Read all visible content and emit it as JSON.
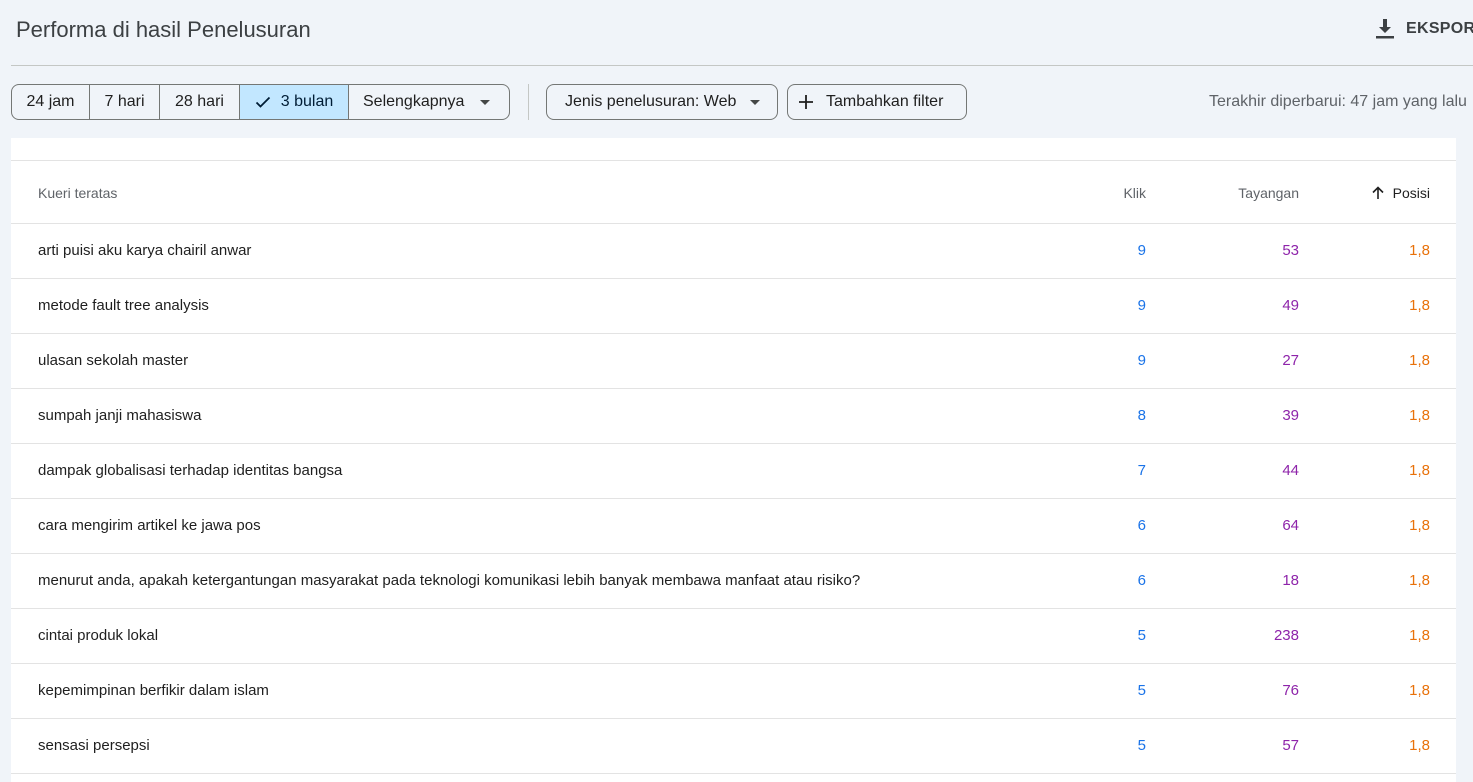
{
  "header": {
    "title": "Performa di hasil Penelusuran",
    "export_label": "EKSPOR"
  },
  "filters": {
    "date_ranges": [
      {
        "label": "24 jam",
        "selected": false
      },
      {
        "label": "7 hari",
        "selected": false
      },
      {
        "label": "28 hari",
        "selected": false
      },
      {
        "label": "3 bulan",
        "selected": true
      },
      {
        "label": "Selengkapnya",
        "selected": false
      }
    ],
    "search_type": "Jenis penelusuran: Web",
    "add_filter": "Tambahkan filter",
    "last_updated": "Terakhir diperbarui: 47 jam yang lalu"
  },
  "table": {
    "headers": {
      "query": "Kueri teratas",
      "clicks": "Klik",
      "impressions": "Tayangan",
      "position": "Posisi"
    },
    "sort": {
      "column": "position",
      "direction": "ascending"
    },
    "rows": [
      {
        "query": "arti puisi aku karya chairil anwar",
        "clicks": "9",
        "impressions": "53",
        "position": "1,8"
      },
      {
        "query": "metode fault tree analysis",
        "clicks": "9",
        "impressions": "49",
        "position": "1,8"
      },
      {
        "query": "ulasan sekolah master",
        "clicks": "9",
        "impressions": "27",
        "position": "1,8"
      },
      {
        "query": "sumpah janji mahasiswa",
        "clicks": "8",
        "impressions": "39",
        "position": "1,8"
      },
      {
        "query": "dampak globalisasi terhadap identitas bangsa",
        "clicks": "7",
        "impressions": "44",
        "position": "1,8"
      },
      {
        "query": "cara mengirim artikel ke jawa pos",
        "clicks": "6",
        "impressions": "64",
        "position": "1,8"
      },
      {
        "query": "menurut anda, apakah ketergantungan masyarakat pada teknologi komunikasi lebih banyak membawa manfaat atau risiko?",
        "clicks": "6",
        "impressions": "18",
        "position": "1,8"
      },
      {
        "query": "cintai produk lokal",
        "clicks": "5",
        "impressions": "238",
        "position": "1,8"
      },
      {
        "query": "kepemimpinan berfikir dalam islam",
        "clicks": "5",
        "impressions": "76",
        "position": "1,8"
      },
      {
        "query": "sensasi persepsi",
        "clicks": "5",
        "impressions": "57",
        "position": "1,8"
      }
    ]
  },
  "icons": {
    "export": "download-icon",
    "selected": "check-icon",
    "dropdown": "caret-down-icon",
    "add": "plus-icon",
    "sort": "arrow-up-icon"
  },
  "colors": {
    "clicks": "#1a73e8",
    "impressions": "#8e24aa",
    "position": "#e8710a",
    "selected_chip": "#c2e7ff"
  }
}
